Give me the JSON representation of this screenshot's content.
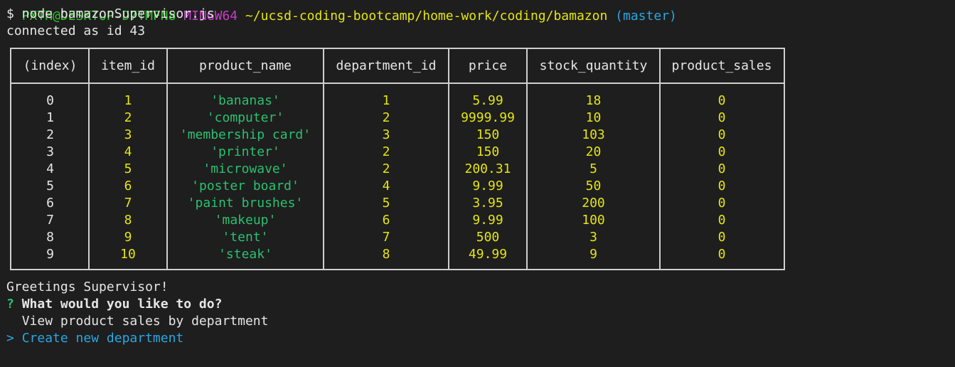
{
  "terminal": {
    "prompt_user": "PXTH@DESKTOP-D7TMFN8",
    "prompt_env": "MINGW64",
    "prompt_path": "~/ucsd-coding-bootcamp/home-work/coding/bamazon",
    "prompt_branch": "(master)",
    "command": "$ node bamazonSupervisor.js",
    "connected": "connected as id 43"
  },
  "table": {
    "headers": [
      "(index)",
      "item_id",
      "product_name",
      "department_id",
      "price",
      "stock_quantity",
      "product_sales"
    ],
    "rows": [
      [
        "0",
        "1",
        "'bananas'",
        "1",
        "5.99",
        "18",
        "0"
      ],
      [
        "1",
        "2",
        "'computer'",
        "2",
        "9999.99",
        "10",
        "0"
      ],
      [
        "2",
        "3",
        "'membership card'",
        "3",
        "150",
        "103",
        "0"
      ],
      [
        "3",
        "4",
        "'printer'",
        "2",
        "150",
        "20",
        "0"
      ],
      [
        "4",
        "5",
        "'microwave'",
        "2",
        "200.31",
        "5",
        "0"
      ],
      [
        "5",
        "6",
        "'poster board'",
        "4",
        "9.99",
        "50",
        "0"
      ],
      [
        "6",
        "7",
        "'paint brushes'",
        "5",
        "3.95",
        "200",
        "0"
      ],
      [
        "7",
        "8",
        "'makeup'",
        "6",
        "9.99",
        "100",
        "0"
      ],
      [
        "8",
        "9",
        "'tent'",
        "7",
        "500",
        "3",
        "0"
      ],
      [
        "9",
        "10",
        "'steak'",
        "8",
        "49.99",
        "9",
        "0"
      ]
    ]
  },
  "menu": {
    "greeting": "Greetings Supervisor!",
    "question_mark": "?",
    "question": "What would you like to do?",
    "option_1": "View product sales by department",
    "pointer": ">",
    "option_2": "Create new department"
  },
  "colors": {
    "background": "#1e1e1e",
    "string_value": "#2bc06f",
    "number_value": "#e5e510",
    "selected_option": "#2aa6e2"
  }
}
